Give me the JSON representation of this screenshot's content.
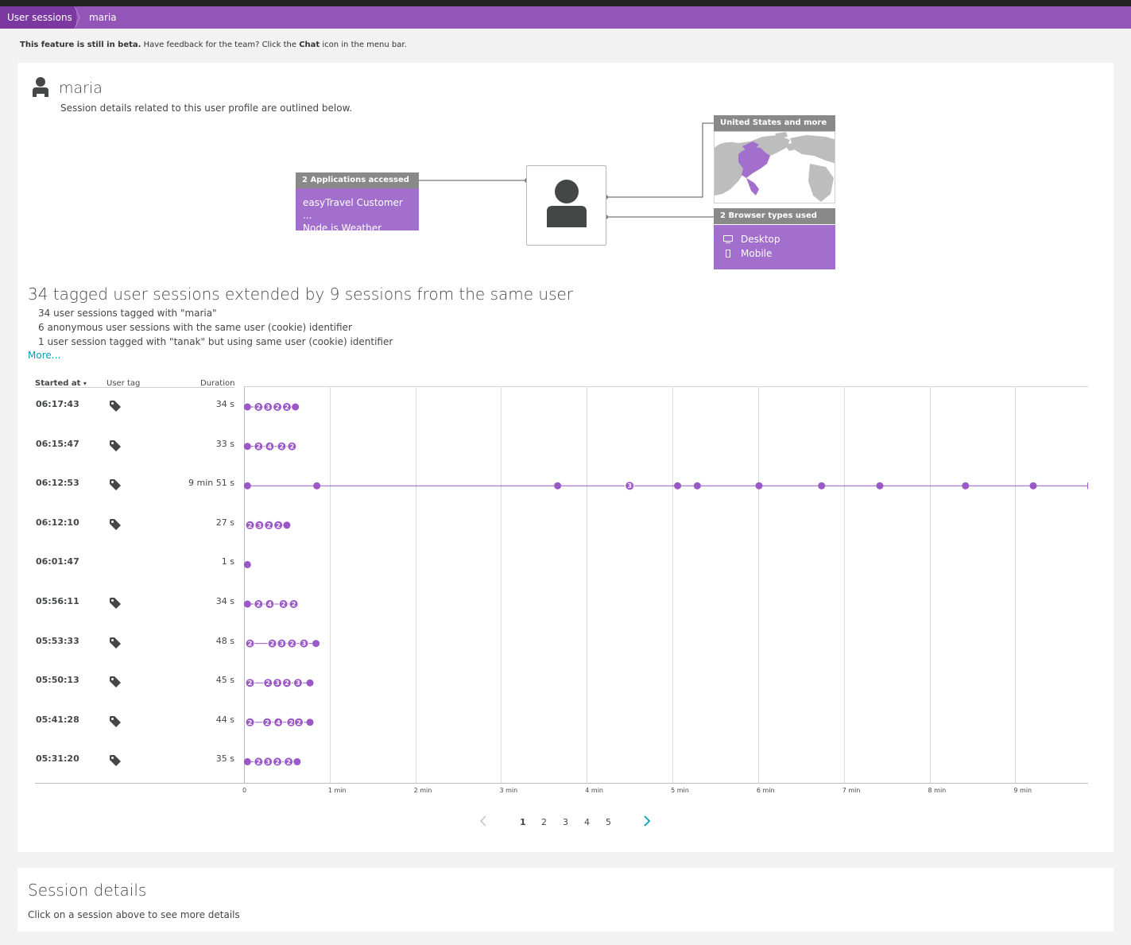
{
  "breadcrumb": {
    "root": "User sessions",
    "current": "maria"
  },
  "beta": {
    "bold": "This feature is still in beta.",
    "text1": " Have feedback for the team? Click the ",
    "chat": "Chat",
    "text2": " icon in the menu bar."
  },
  "user": {
    "name": "maria",
    "subtitle": "Session details related to this user profile are outlined below."
  },
  "apps": {
    "header": "2 Applications accessed",
    "items": [
      "easyTravel Customer ...",
      "Node.js Weather"
    ]
  },
  "geo": {
    "header": "United States and more"
  },
  "browsers": {
    "header": "2 Browser types used",
    "items": [
      "Desktop",
      "Mobile"
    ]
  },
  "summary": {
    "title": "34 tagged user sessions extended by 9 sessions from the same user",
    "lines": [
      "34 user sessions tagged with \"maria\"",
      "6 anonymous user sessions with the same user (cookie) identifier",
      "1 user session tagged with \"tanak\" but using same user (cookie) identifier"
    ],
    "more": "More..."
  },
  "table": {
    "headers": {
      "started": "Started at",
      "sort_arrow": "▾",
      "tag": "User tag",
      "duration": "Duration"
    },
    "rows": [
      {
        "time": "06:17:43",
        "tagged": true,
        "duration": "34 s"
      },
      {
        "time": "06:15:47",
        "tagged": true,
        "duration": "33 s"
      },
      {
        "time": "06:12:53",
        "tagged": true,
        "duration": "9 min 51 s"
      },
      {
        "time": "06:12:10",
        "tagged": true,
        "duration": "27 s"
      },
      {
        "time": "06:01:47",
        "tagged": false,
        "duration": "1 s"
      },
      {
        "time": "05:56:11",
        "tagged": true,
        "duration": "34 s"
      },
      {
        "time": "05:53:33",
        "tagged": true,
        "duration": "48 s"
      },
      {
        "time": "05:50:13",
        "tagged": true,
        "duration": "45 s"
      },
      {
        "time": "05:41:28",
        "tagged": true,
        "duration": "44 s"
      },
      {
        "time": "05:31:20",
        "tagged": true,
        "duration": "35 s"
      }
    ]
  },
  "chart_data": {
    "type": "scatter",
    "x_unit": "min",
    "xlim": [
      0,
      9.85
    ],
    "x_ticks": [
      "0",
      "1 min",
      "2 min",
      "3 min",
      "4 min",
      "5 min",
      "6 min",
      "7 min",
      "8 min",
      "9 min"
    ],
    "accent": "#9b59c8",
    "rows": [
      {
        "events": [
          [
            0.04,
            ""
          ],
          [
            0.17,
            "2"
          ],
          [
            0.28,
            "3"
          ],
          [
            0.39,
            "2"
          ],
          [
            0.5,
            "2"
          ],
          [
            0.6,
            ""
          ]
        ]
      },
      {
        "events": [
          [
            0.04,
            ""
          ],
          [
            0.17,
            "2"
          ],
          [
            0.3,
            "4"
          ],
          [
            0.44,
            "2"
          ],
          [
            0.56,
            "2"
          ]
        ]
      },
      {
        "events": [
          [
            0.04,
            ""
          ],
          [
            0.85,
            ""
          ],
          [
            3.66,
            ""
          ],
          [
            4.5,
            "3"
          ],
          [
            5.06,
            ""
          ],
          [
            5.29,
            ""
          ],
          [
            6.01,
            ""
          ],
          [
            6.74,
            ""
          ],
          [
            7.42,
            ""
          ],
          [
            8.42,
            ""
          ],
          [
            9.21,
            ""
          ]
        ]
      },
      {
        "events": [
          [
            0.07,
            "2"
          ],
          [
            0.18,
            "3"
          ],
          [
            0.29,
            "2"
          ],
          [
            0.4,
            "2"
          ],
          [
            0.5,
            ""
          ]
        ]
      },
      {
        "events": [
          [
            0.04,
            ""
          ]
        ]
      },
      {
        "events": [
          [
            0.04,
            ""
          ],
          [
            0.17,
            "2"
          ],
          [
            0.3,
            "4"
          ],
          [
            0.46,
            "2"
          ],
          [
            0.58,
            "2"
          ]
        ]
      },
      {
        "events": [
          [
            0.07,
            "2"
          ],
          [
            0.33,
            "2"
          ],
          [
            0.44,
            "3"
          ],
          [
            0.56,
            "2"
          ],
          [
            0.7,
            "3"
          ],
          [
            0.84,
            ""
          ]
        ]
      },
      {
        "events": [
          [
            0.07,
            "2"
          ],
          [
            0.28,
            "2"
          ],
          [
            0.39,
            "3"
          ],
          [
            0.5,
            "2"
          ],
          [
            0.63,
            "3"
          ],
          [
            0.77,
            ""
          ]
        ]
      },
      {
        "events": [
          [
            0.07,
            "2"
          ],
          [
            0.27,
            "2"
          ],
          [
            0.4,
            "4"
          ],
          [
            0.55,
            "2"
          ],
          [
            0.64,
            "2"
          ],
          [
            0.77,
            ""
          ]
        ]
      },
      {
        "events": [
          [
            0.04,
            ""
          ],
          [
            0.17,
            "2"
          ],
          [
            0.28,
            "3"
          ],
          [
            0.39,
            "2"
          ],
          [
            0.52,
            "2"
          ],
          [
            0.62,
            ""
          ]
        ]
      }
    ]
  },
  "pagination": {
    "pages": [
      "1",
      "2",
      "3",
      "4",
      "5"
    ],
    "current": "1"
  },
  "details": {
    "title": "Session details",
    "subtitle": "Click on a session above to see more details"
  },
  "colors": {
    "purple": "#9355b7",
    "purple_dark": "#7c38a1",
    "box_purple": "#a26fcc",
    "header_gray": "#898989",
    "link": "#00a1b2"
  }
}
